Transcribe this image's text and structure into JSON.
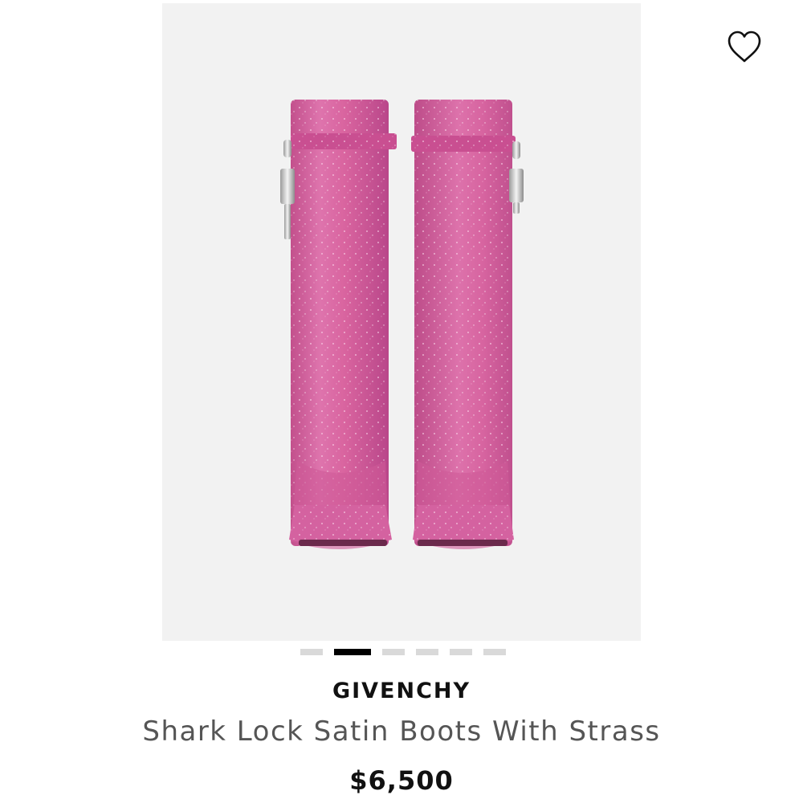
{
  "product": {
    "brand": "GIVENCHY",
    "name": "Shark Lock Satin Boots With Strass",
    "price": "$6,500",
    "image": {
      "subject": "pair of pink strass knee-high boots",
      "color": "#d4609c"
    }
  },
  "gallery": {
    "total_images": 6,
    "active_index": 1
  },
  "wishlist": {
    "icon": "heart-outline-icon",
    "favorited": false
  }
}
